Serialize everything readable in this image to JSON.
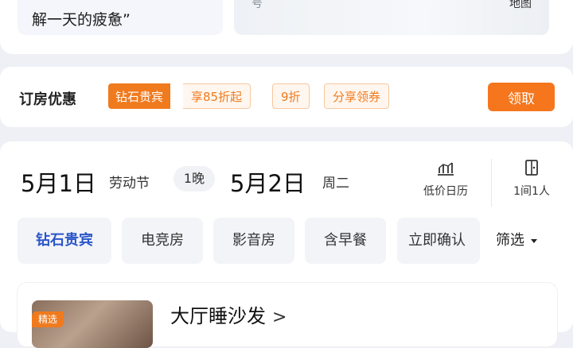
{
  "top_card": {
    "review_text": "解一天的疲惫”",
    "image_fragment_left": "号",
    "image_fragment_right": "地图"
  },
  "discount": {
    "title": "订房优惠",
    "tags": [
      "钻石贵宾",
      "享85折起",
      "9折",
      "分享领券"
    ],
    "claim_label": "领取"
  },
  "dates": {
    "checkin_date": "5月1日",
    "checkin_holiday": "劳动节",
    "nights": "1晚",
    "checkout_date": "5月2日",
    "checkout_weekday": "周二",
    "calendar_label": "低价日历",
    "room_guest_label": "1间1人"
  },
  "filters": {
    "chips": [
      "钻石贵宾",
      "电竞房",
      "影音房",
      "含早餐",
      "立即确认"
    ],
    "filter_label": "筛选"
  },
  "room": {
    "name": "大厅睡沙发",
    "chevron": ">",
    "thumb_badge": "精选"
  },
  "colors": {
    "accent_orange": "#f5761c",
    "diamond_blue": "#2b56c9",
    "background": "#eef0f6"
  }
}
